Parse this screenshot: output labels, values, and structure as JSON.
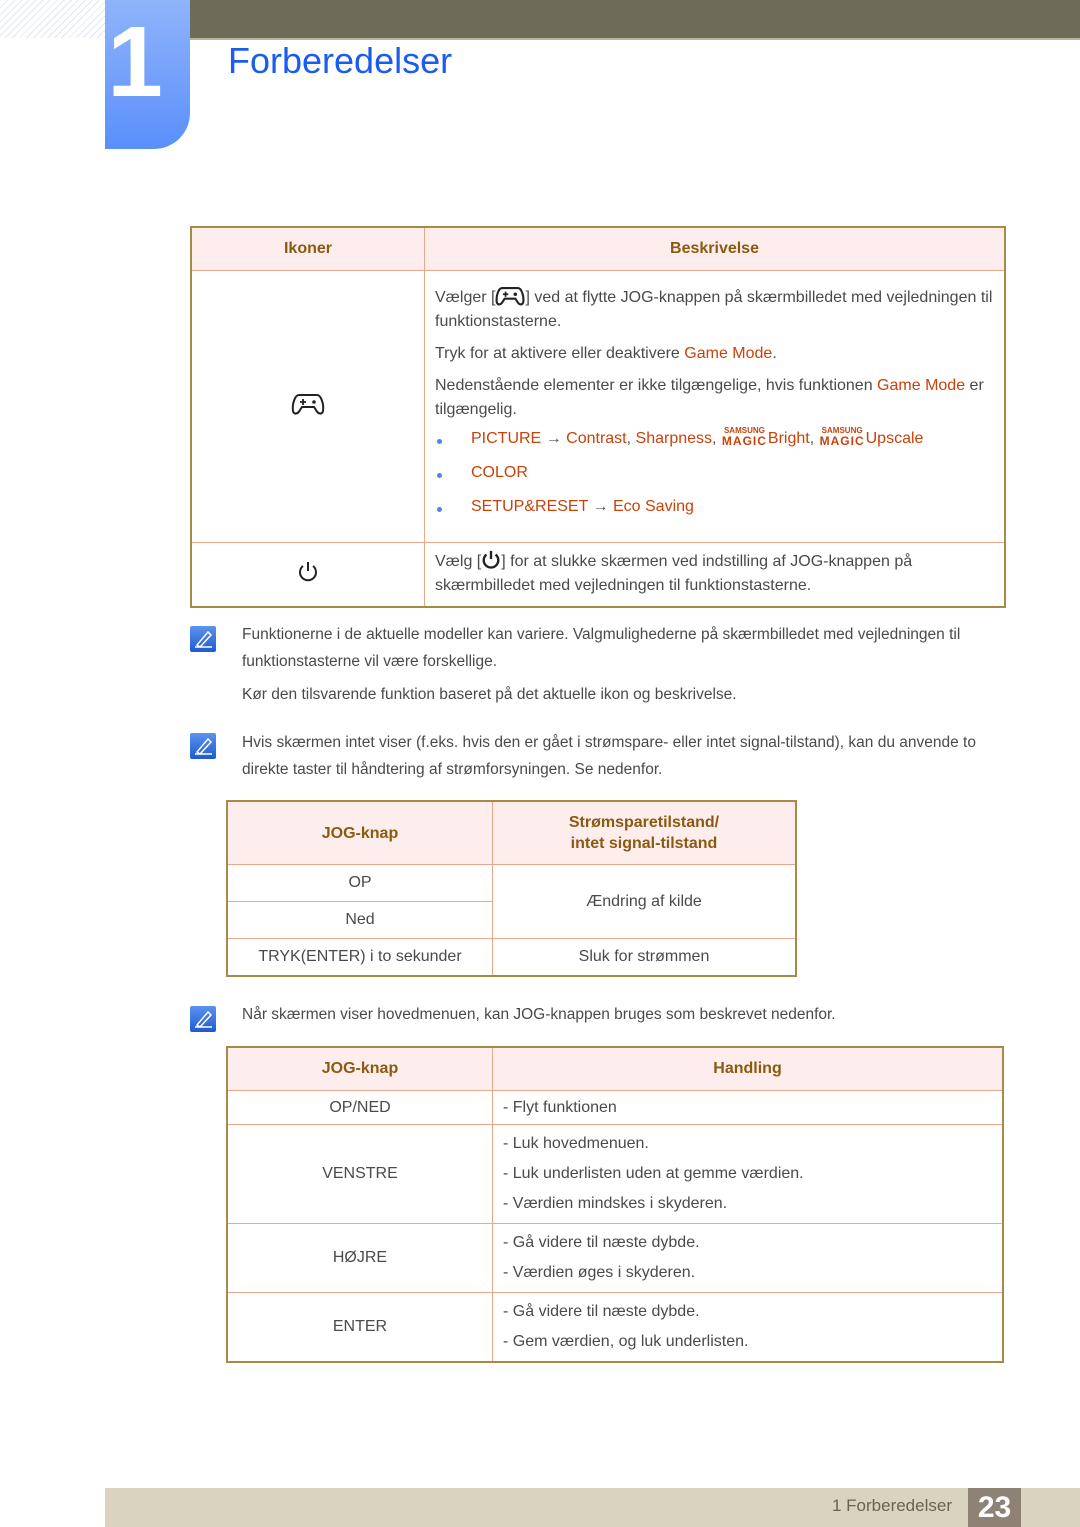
{
  "header": {
    "chapter_number": "1",
    "chapter_title": "Forberedelser"
  },
  "icons_table": {
    "headers": [
      "Ikoner",
      "Beskrivelse"
    ],
    "rows": [
      {
        "icon": "gamepad-icon",
        "desc": {
          "p1_before": "Vælger [",
          "p1_after": "] ved at flytte JOG-knappen på skærmbilledet med vejledningen til funktionstasterne.",
          "p2_before": "Tryk for at aktivere eller deaktivere ",
          "p2_highlight": "Game Mode",
          "p2_after": ".",
          "p3_before": "Nedenstående elementer er ikke tilgængelige, hvis funktionen ",
          "p3_highlight": "Game Mode",
          "p3_after": " er tilgængelig.",
          "bullets": [
            {
              "menu": "PICTURE",
              "arrow": "→",
              "items": [
                "Contrast",
                "Sharpness",
                "Bright",
                "Upscale"
              ],
              "magic_prefix_top": "SAMSUNG",
              "magic_prefix_bottom": "MAGIC"
            },
            {
              "menu": "COLOR"
            },
            {
              "menu": "SETUP&RESET",
              "arrow": "→",
              "items": [
                "Eco Saving"
              ]
            }
          ]
        }
      },
      {
        "icon": "power-icon",
        "desc": {
          "before": "Vælg [",
          "after": "] for at slukke skærmen ved indstilling af JOG-knappen på skærmbilledet med vejledningen til funktionstasterne."
        }
      }
    ]
  },
  "notes": [
    {
      "paragraphs": [
        "Funktionerne i de aktuelle modeller kan variere. Valgmulighederne på skærmbilledet med vejledningen til funktionstasterne vil være forskellige.",
        "Kør den tilsvarende funktion baseret på det aktuelle ikon og beskrivelse."
      ]
    },
    {
      "paragraphs": [
        "Hvis skærmen intet viser (f.eks. hvis den er gået i strømspare- eller intet signal-tilstand), kan du anvende to direkte taster til håndtering af strømforsyningen. Se nedenfor."
      ]
    },
    {
      "paragraphs": [
        "Når skærmen viser hovedmenuen, kan JOG-knappen bruges som beskrevet nedenfor."
      ]
    }
  ],
  "power_table": {
    "headers": [
      "JOG-knap",
      "Strømsparetilstand/",
      "intet signal-tilstand"
    ],
    "rows": [
      {
        "key": "OP",
        "action": "Ændring af kilde"
      },
      {
        "key": "Ned"
      },
      {
        "key": "TRYK(ENTER) i to sekunder",
        "action": "Sluk for strømmen"
      }
    ]
  },
  "menu_table": {
    "headers": [
      "JOG-knap",
      "Handling"
    ],
    "rows": [
      {
        "key": "OP/NED",
        "actions": [
          "- Flyt funktionen"
        ]
      },
      {
        "key": "VENSTRE",
        "actions": [
          "- Luk hovedmenuen.",
          "- Luk underlisten uden at gemme værdien.",
          "- Værdien mindskes i skyderen."
        ]
      },
      {
        "key": "HØJRE",
        "actions": [
          "- Gå videre til næste dybde.",
          "- Værdien øges i skyderen."
        ]
      },
      {
        "key": "ENTER",
        "actions": [
          "- Gå videre til næste dybde.",
          "- Gem værdien, og luk underlisten."
        ]
      }
    ]
  },
  "footer": {
    "section_label": "1 Forberedelser",
    "page_number": "23"
  },
  "colors": {
    "accent_blue": "#1a5cf0",
    "highlight_orange": "#c8420a",
    "header_bar": "#6d6c58",
    "table_header_bg": "#fdeeed",
    "footer_bg": "#d9d3c0",
    "page_box": "#8e8274"
  }
}
